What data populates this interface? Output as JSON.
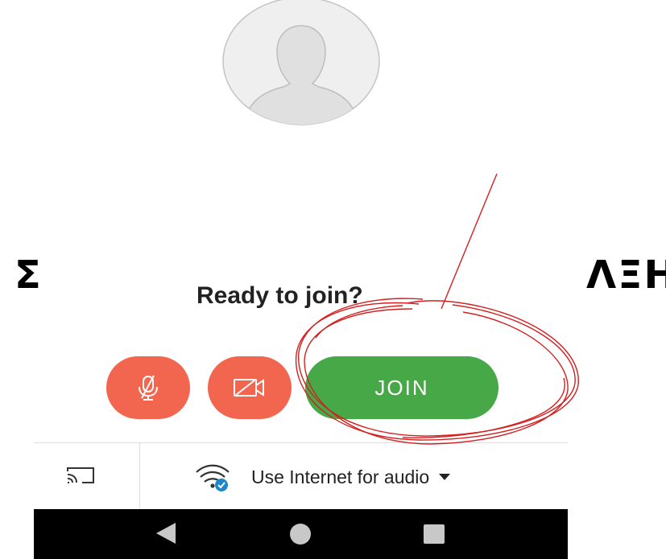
{
  "overlay": {
    "left_text": "Σ",
    "right_text": "ΛΞΗ"
  },
  "prejoin": {
    "title": "Ready to join?",
    "join_label": "JOIN",
    "mic_state": "muted",
    "camera_state": "off"
  },
  "audio": {
    "label": "Use Internet for audio"
  },
  "colors": {
    "mic_button": "#f26650",
    "camera_button": "#f26650",
    "join_button": "#46a847",
    "nav_bar": "#000000",
    "annotation": "#d32020"
  },
  "icons": {
    "avatar": "person-silhouette",
    "mic": "mic-off-icon",
    "camera": "camera-off-icon",
    "cast": "cast-icon",
    "wifi": "wifi-check-icon",
    "nav_back": "back-triangle-icon",
    "nav_home": "home-circle-icon",
    "nav_recents": "recents-square-icon"
  }
}
